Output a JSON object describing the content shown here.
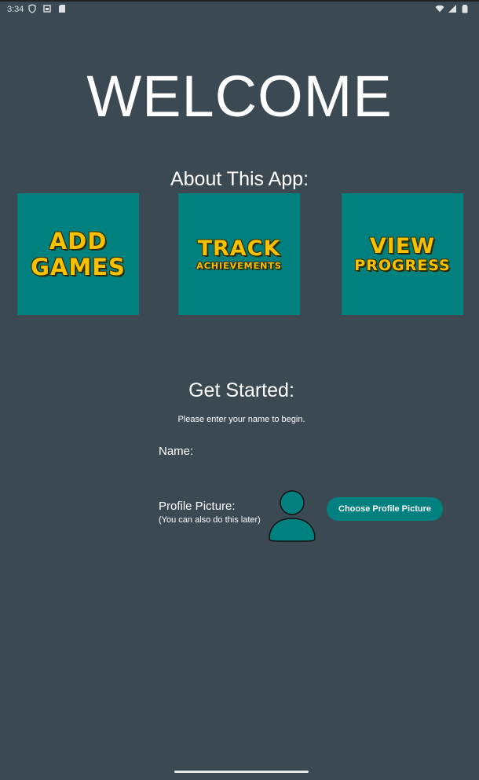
{
  "status_bar": {
    "time": "3:34",
    "icons": [
      "shield-icon",
      "photo-icon",
      "sd-card-icon",
      "wifi-icon",
      "signal-icon",
      "battery-icon"
    ]
  },
  "welcome": "WELCOME",
  "about_title": "About This App:",
  "tiles": [
    {
      "line1": "ADD",
      "line2": "GAMES"
    },
    {
      "line1": "TRACK",
      "line2": "ACHIEVEMENTS"
    },
    {
      "line1": "VIEW",
      "line2": "PROGRESS"
    }
  ],
  "get_started": "Get Started:",
  "instructions": "Please enter your name to begin.",
  "name_label": "Name:",
  "name_value": "",
  "profile_label": "Profile Picture:",
  "profile_sub": "(You can also do this later)",
  "choose_button": "Choose Profile Picture",
  "colors": {
    "background": "#3b4952",
    "accent": "#00807e",
    "tile_text": "#f6c200"
  }
}
